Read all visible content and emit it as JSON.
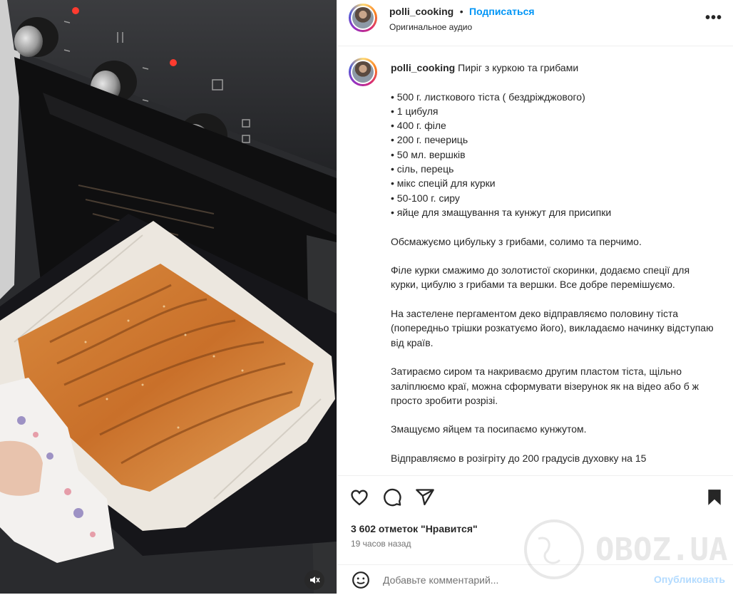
{
  "post": {
    "username": "polli_cooking",
    "separator": "•",
    "follow_label": "Подписаться",
    "audio_label": "Оригинальное аудио",
    "more_label": "•••"
  },
  "caption": {
    "username": "polli_cooking",
    "title": "Пиріг з куркою та грибами",
    "body": "• 500 г. листкового тіста ( бездріжджового)\n• 1 цибуля\n• 400 г. філе\n• 200 г. печериць\n• 50 мл. вершків\n• сіль, перець\n• мікс спецій для курки\n• 50-100 г. сиру\n• яйце для змащування та кунжут для присипки\n\nОбсмажуємо цибульку з грибами, солимо та перчимо.\n\nФіле курки смажимо до золотистої скоринки, додаємо спеції для курки, цибулю з грибами та вершки. Все добре перемішуємо.\n\nНа застелене пергаментом деко відправляємо половину тіста (попередньо трішки розкатуємо його), викладаємо начинку відступаю від країв.\n\nЗатираємо сиром та накриваємо другим пластом тіста, щільно заліплюємо краї, можна сформувати візерунок як на відео або б ж просто зробити розрізі.\n\nЗмащуємо яйцем та посипаємо кунжутом.\n\nВідправляємо в розігріту до 200 градусів духовку на 15"
  },
  "stats": {
    "likes": "3 602 отметок \"Нравится\"",
    "time_ago": "19 часов назад"
  },
  "comment": {
    "placeholder": "Добавьте комментарий...",
    "publish_label": "Опубликовать"
  },
  "watermark": {
    "text": "OBOZ.UA"
  },
  "colors": {
    "accent": "#0095f6",
    "publish_disabled": "#b3dbff",
    "text": "#262626",
    "secondary": "#737373"
  },
  "icons": [
    "heart-icon",
    "comment-icon",
    "share-icon",
    "bookmark-icon",
    "emoji-icon",
    "mute-icon",
    "more-icon"
  ]
}
